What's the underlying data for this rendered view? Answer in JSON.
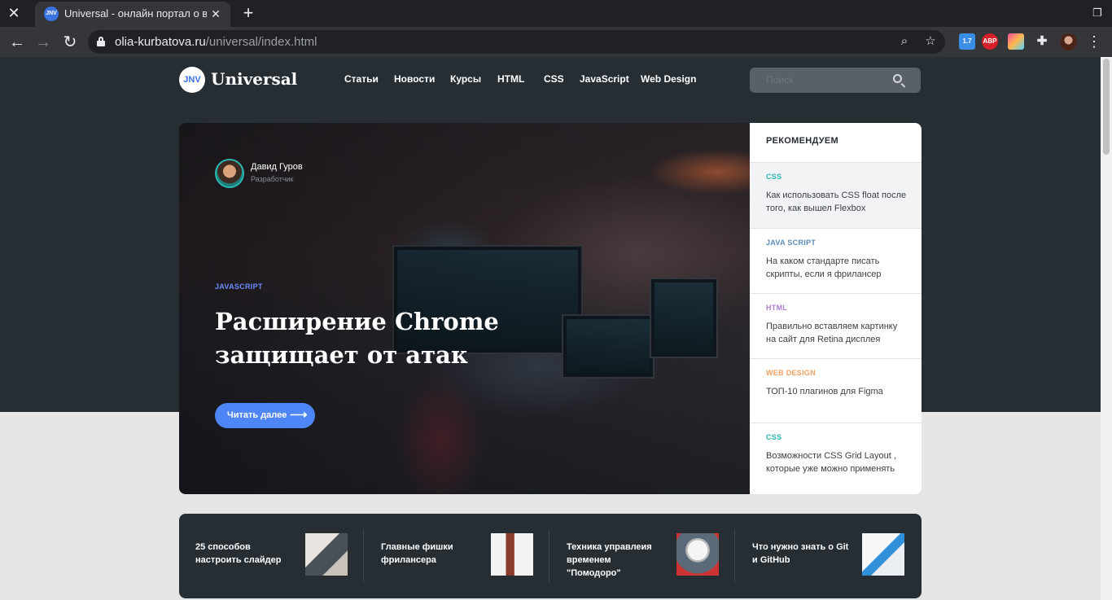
{
  "browser": {
    "tab_title": "Universal - онлайн портал о веб",
    "favicon_text": "JNV",
    "url_host": "olia-kurbatova.ru",
    "url_path": "/universal/index.html",
    "ext_badge_1": "1.7",
    "ext_badge_2": "ABP"
  },
  "site": {
    "logo_mark": "JNV",
    "logo_text": "Universal",
    "nav": [
      "Статьи",
      "Новости",
      "Курсы",
      "HTML",
      "CSS",
      "JavaScript",
      "Web Design"
    ],
    "search_placeholder": "Поиск"
  },
  "hero": {
    "author_name": "Давид Гуров",
    "author_role": "Разработчик",
    "category": "JAVASCRIPT",
    "title": "Расширение Chrome защищает от атак",
    "button_label": "Читать далее",
    "button_arrow": "⟶"
  },
  "recommend": {
    "heading": "РЕКОМЕНДУЕМ",
    "items": [
      {
        "category": "CSS",
        "color": "#2bb6b2",
        "text": "Как использовать CSS float после того, как вышел Flexbox",
        "highlighted": true
      },
      {
        "category": "JAVA SCRIPT",
        "color": "#5b8db8",
        "text": "На каком стандарте писать скрипты, если я фрилансер",
        "highlighted": false
      },
      {
        "category": "HTML",
        "color": "#b07ed0",
        "text": "Правильно вставляем картинку на сайт для Retina дисплея",
        "highlighted": false
      },
      {
        "category": "WEB DESIGN",
        "color": "#f0a060",
        "text": "ТОП-10 плагинов для Figma",
        "highlighted": false
      },
      {
        "category": "CSS",
        "color": "#2bb6b2",
        "text": "Возможности CSS Grid Layout , которые уже можно применять",
        "highlighted": false
      }
    ]
  },
  "strip": {
    "items": [
      {
        "text": "25 способов настроить слайдер",
        "icon": "laptop-thumbnail"
      },
      {
        "text": "Главные фишки фрилансера",
        "icon": "whiteboard-thumbnail"
      },
      {
        "text": "Техника управлеия временем \"Помодоро\"",
        "icon": "clock-thumbnail"
      },
      {
        "text": "Что нужно знать о Git и GitHub",
        "icon": "devices-thumbnail"
      }
    ]
  }
}
